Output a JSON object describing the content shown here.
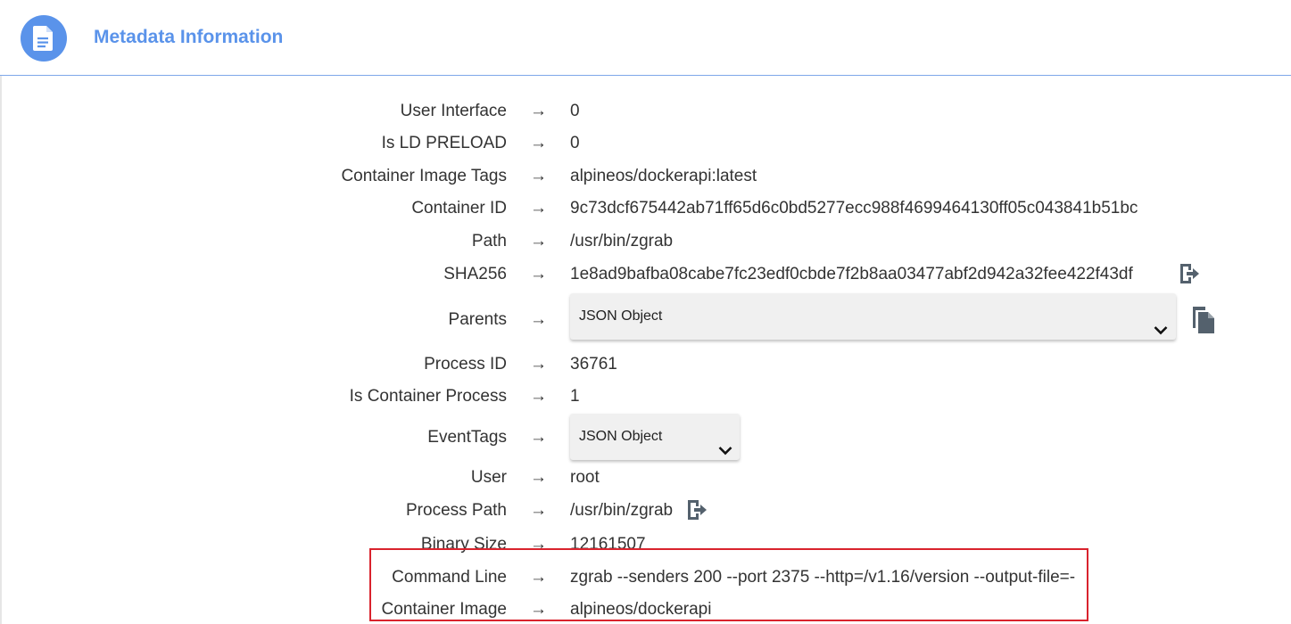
{
  "header": {
    "title": "Metadata Information",
    "icon": "document-icon"
  },
  "colors": {
    "accent": "#5a93ea",
    "highlight": "#d9232d"
  },
  "arrow": "→",
  "fields": {
    "user_interface": {
      "label": "User Interface",
      "value": "0"
    },
    "is_ld_preload": {
      "label": "Is LD PRELOAD",
      "value": "0"
    },
    "container_image_tags": {
      "label": "Container Image Tags",
      "value": "alpineos/dockerapi:latest"
    },
    "container_id": {
      "label": "Container ID",
      "value": "9c73dcf675442ab71ff65d6c0bd5277ecc988f4699464130ff05c043841b51bc"
    },
    "path": {
      "label": "Path",
      "value": "/usr/bin/zgrab"
    },
    "sha256": {
      "label": "SHA256",
      "value": "1e8ad9bafba08cabe7fc23edf0cbde7f2b8aa03477abf2d942a32fee422f43df",
      "icon": "open-external-icon"
    },
    "parents": {
      "label": "Parents",
      "value": "JSON Object",
      "icon": "copy-icon"
    },
    "process_id": {
      "label": "Process ID",
      "value": "36761"
    },
    "is_container_process": {
      "label": "Is Container Process",
      "value": "1"
    },
    "event_tags": {
      "label": "EventTags",
      "value": "JSON Object"
    },
    "user": {
      "label": "User",
      "value": "root"
    },
    "process_path": {
      "label": "Process Path",
      "value": "/usr/bin/zgrab",
      "icon": "open-external-icon"
    },
    "binary_size": {
      "label": "Binary Size",
      "value": "12161507"
    },
    "command_line": {
      "label": "Command Line",
      "value": "zgrab --senders 200 --port 2375 --http=/v1.16/version --output-file=-"
    },
    "container_image": {
      "label": "Container Image",
      "value": "alpineos/dockerapi"
    }
  }
}
